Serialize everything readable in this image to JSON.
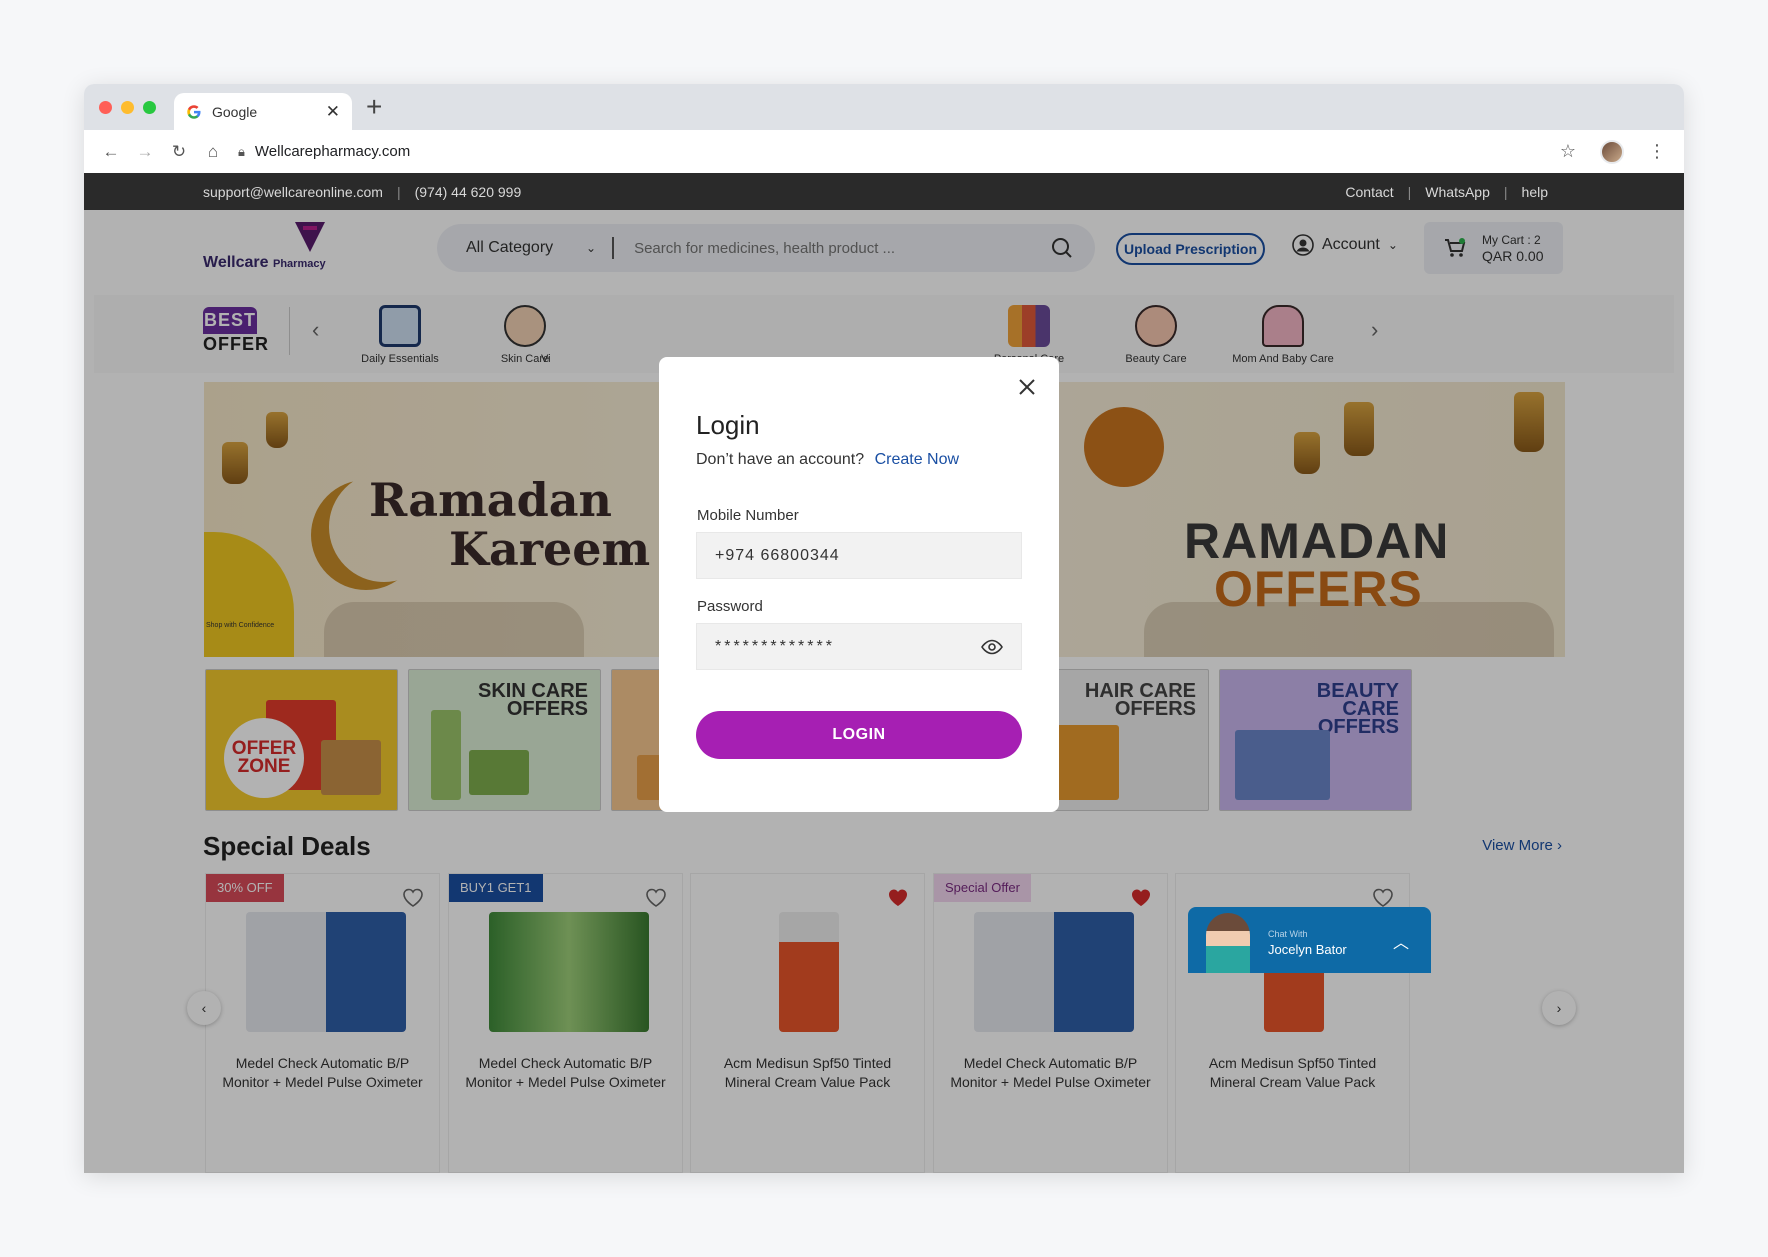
{
  "browser": {
    "tab_title": "Google",
    "url": "Wellcarepharmacy.com"
  },
  "topbar": {
    "email": "support@wellcareonline.com",
    "phone": "(974) 44 620 999",
    "links": [
      "Contact",
      "WhatsApp",
      "help"
    ]
  },
  "header": {
    "logo_name": "Wellcare",
    "logo_suffix": "Pharmacy",
    "category_select": "All Category",
    "search_placeholder": "Search for medicines, health product ...",
    "upload_label": "Upload Prescription",
    "account_label": "Account",
    "cart_label": "My Cart : 2",
    "cart_amount": "QAR 0.00"
  },
  "categories": {
    "best_offer_top": "BEST",
    "best_offer_bottom": "OFFER",
    "items": [
      "Daily Essentials",
      "Skin Care",
      "Vi",
      "Personal Care",
      "Beauty Care",
      "Mom And Baby Care"
    ]
  },
  "banner": {
    "left_line1": "Ramadan",
    "left_line2": "Kareem",
    "right_line1": "RAMADAN",
    "right_line2": "OFFERS",
    "confidence": "Shop with Confidence"
  },
  "offer_tiles": [
    {
      "title": "OFFER ZONE"
    },
    {
      "title_line1": "SKIN CARE",
      "title_line2": "OFFERS"
    },
    {
      "title": ""
    },
    {
      "title": ""
    },
    {
      "title_line1": "HAIR CARE",
      "title_line2": "OFFERS"
    },
    {
      "title_line1": "BEAUTY",
      "title_line2": "CARE",
      "title_line3": "OFFERS"
    }
  ],
  "deals": {
    "title": "Special Deals",
    "view_more": "View More",
    "cards": [
      {
        "badge": "30% OFF",
        "badge_color": "#d94b5a",
        "liked": false,
        "name_line1": "Medel Check Automatic B/P",
        "name_line2": "Monitor + Medel Pulse Oximeter"
      },
      {
        "badge": "BUY1 GET1",
        "badge_color": "#1a4fa3",
        "liked": false,
        "name_line1": "Medel Check Automatic B/P",
        "name_line2": "Monitor + Medel Pulse Oximeter"
      },
      {
        "badge": "",
        "badge_color": "",
        "liked": true,
        "name_line1": "Acm Medisun Spf50 Tinted",
        "name_line2": "Mineral Cream Value Pack"
      },
      {
        "badge": "Special Offer",
        "badge_color": "#f3d6ef",
        "liked": true,
        "name_line1": "Medel Check Automatic B/P",
        "name_line2": "Monitor + Medel Pulse Oximeter"
      },
      {
        "badge": "",
        "badge_color": "",
        "liked": false,
        "name_line1": "Acm Medisun Spf50 Tinted",
        "name_line2": "Mineral Cream Value Pack"
      }
    ]
  },
  "chat": {
    "prefix": "Chat With",
    "agent": "Jocelyn Bator"
  },
  "login_modal": {
    "title": "Login",
    "no_account": "Don’t have an account?",
    "create_now": "Create Now",
    "mobile_label": "Mobile Number",
    "mobile_value": "+974 66800344",
    "password_label": "Password",
    "password_value": "*************",
    "login_button": "LOGIN"
  },
  "colors": {
    "accent_purple": "#a61fb3",
    "link_blue": "#1a4fa3",
    "topbar_bg": "#2a2a2a"
  }
}
